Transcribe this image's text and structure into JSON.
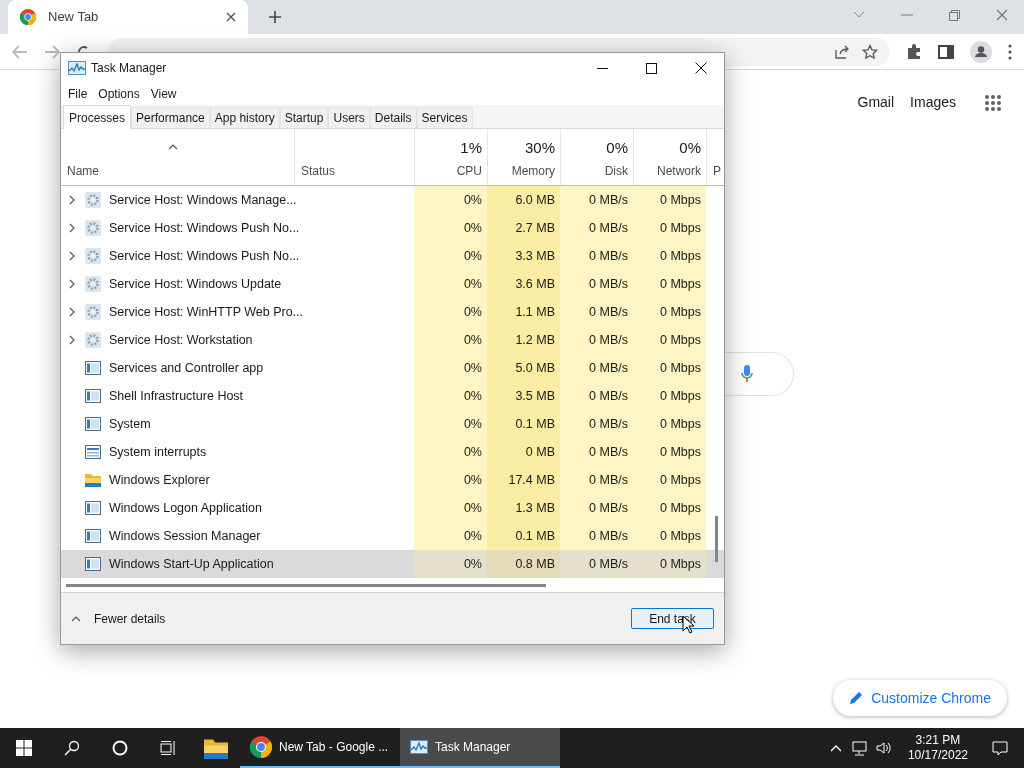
{
  "browser": {
    "tab_title": "New Tab",
    "links": [
      "Gmail",
      "Images"
    ],
    "customize_button": "Customize Chrome"
  },
  "task_manager": {
    "title": "Task Manager",
    "menu": [
      "File",
      "Options",
      "View"
    ],
    "tabs": [
      {
        "label": "Processes",
        "selected": true
      },
      {
        "label": "Performance",
        "selected": false
      },
      {
        "label": "App history",
        "selected": false
      },
      {
        "label": "Startup",
        "selected": false
      },
      {
        "label": "Users",
        "selected": false
      },
      {
        "label": "Details",
        "selected": false
      },
      {
        "label": "Services",
        "selected": false
      }
    ],
    "columns": [
      {
        "label": "Name"
      },
      {
        "label": "Status"
      },
      {
        "percent": "1%",
        "label": "CPU"
      },
      {
        "percent": "30%",
        "label": "Memory"
      },
      {
        "percent": "0%",
        "label": "Disk"
      },
      {
        "percent": "0%",
        "label": "Network"
      },
      {
        "label": "P"
      }
    ],
    "rows": [
      {
        "name": "Service Host: Windows Manage...",
        "kind": "service",
        "expandable": true,
        "selected": false,
        "cpu": "0%",
        "memory": "6.0 MB",
        "disk": "0 MB/s",
        "network": "0 Mbps"
      },
      {
        "name": "Service Host: Windows Push No...",
        "kind": "service",
        "expandable": true,
        "selected": false,
        "cpu": "0%",
        "memory": "2.7 MB",
        "disk": "0 MB/s",
        "network": "0 Mbps"
      },
      {
        "name": "Service Host: Windows Push No...",
        "kind": "service",
        "expandable": true,
        "selected": false,
        "cpu": "0%",
        "memory": "3.3 MB",
        "disk": "0 MB/s",
        "network": "0 Mbps"
      },
      {
        "name": "Service Host: Windows Update",
        "kind": "service",
        "expandable": true,
        "selected": false,
        "cpu": "0%",
        "memory": "3.6 MB",
        "disk": "0 MB/s",
        "network": "0 Mbps"
      },
      {
        "name": "Service Host: WinHTTP Web Pro...",
        "kind": "service",
        "expandable": true,
        "selected": false,
        "cpu": "0%",
        "memory": "1.1 MB",
        "disk": "0 MB/s",
        "network": "0 Mbps"
      },
      {
        "name": "Service Host: Workstation",
        "kind": "service",
        "expandable": true,
        "selected": false,
        "cpu": "0%",
        "memory": "1.2 MB",
        "disk": "0 MB/s",
        "network": "0 Mbps"
      },
      {
        "name": "Services and Controller app",
        "kind": "app",
        "expandable": false,
        "selected": false,
        "cpu": "0%",
        "memory": "5.0 MB",
        "disk": "0 MB/s",
        "network": "0 Mbps"
      },
      {
        "name": "Shell Infrastructure Host",
        "kind": "app",
        "expandable": false,
        "selected": false,
        "cpu": "0%",
        "memory": "3.5 MB",
        "disk": "0 MB/s",
        "network": "0 Mbps"
      },
      {
        "name": "System",
        "kind": "app",
        "expandable": false,
        "selected": false,
        "cpu": "0%",
        "memory": "0.1 MB",
        "disk": "0 MB/s",
        "network": "0 Mbps"
      },
      {
        "name": "System interrupts",
        "kind": "interrupts",
        "expandable": false,
        "selected": false,
        "cpu": "0%",
        "memory": "0 MB",
        "disk": "0 MB/s",
        "network": "0 Mbps"
      },
      {
        "name": "Windows Explorer",
        "kind": "folder",
        "expandable": false,
        "selected": false,
        "cpu": "0%",
        "memory": "17.4 MB",
        "disk": "0 MB/s",
        "network": "0 Mbps"
      },
      {
        "name": "Windows Logon Application",
        "kind": "app",
        "expandable": false,
        "selected": false,
        "cpu": "0%",
        "memory": "1.3 MB",
        "disk": "0 MB/s",
        "network": "0 Mbps"
      },
      {
        "name": "Windows Session Manager",
        "kind": "app",
        "expandable": false,
        "selected": false,
        "cpu": "0%",
        "memory": "0.1 MB",
        "disk": "0 MB/s",
        "network": "0 Mbps"
      },
      {
        "name": "Windows Start-Up Application",
        "kind": "app",
        "expandable": false,
        "selected": true,
        "cpu": "0%",
        "memory": "0.8 MB",
        "disk": "0 MB/s",
        "network": "0 Mbps"
      }
    ],
    "fewer_details": "Fewer details",
    "end_task": "End task"
  },
  "taskbar": {
    "apps": [
      {
        "label": "New Tab - Google ...",
        "kind": "chrome",
        "selected": false
      },
      {
        "label": "Task Manager",
        "kind": "taskmgr",
        "selected": true
      }
    ],
    "time": "3:21 PM",
    "date": "10/17/2022"
  }
}
